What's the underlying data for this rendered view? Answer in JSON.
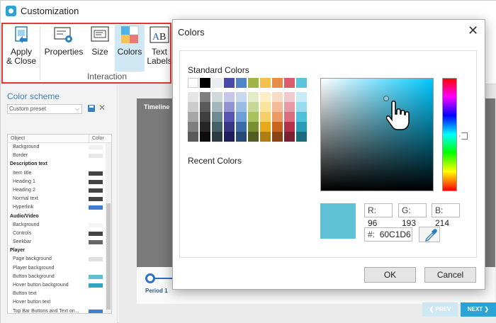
{
  "window": {
    "title": "Customization"
  },
  "ribbon": {
    "buttons": [
      {
        "label_line1": "Apply",
        "label_line2": "& Close",
        "icon": "apply-close-icon"
      },
      {
        "label": "Properties",
        "icon": "properties-icon"
      },
      {
        "label": "Size",
        "icon": "size-icon"
      },
      {
        "label": "Colors",
        "icon": "colors-icon",
        "selected": true
      },
      {
        "label_line1": "Text",
        "label_line2": "Labels",
        "icon": "text-labels-icon"
      }
    ],
    "group_label": "Interaction",
    "highlight_color": "#e53935"
  },
  "left_panel": {
    "color_scheme_label": "Color scheme",
    "preset": "Custom preset",
    "table_header": {
      "object": "Object",
      "color": "Color"
    },
    "rows": [
      {
        "type": "item",
        "label": "Background",
        "color": "#f0f0f0"
      },
      {
        "type": "item",
        "label": "Border",
        "color": "#e6e6e6"
      },
      {
        "type": "cat",
        "label": "Description text"
      },
      {
        "type": "item",
        "label": "Item title",
        "color": "#444444"
      },
      {
        "type": "item",
        "label": "Heading 1",
        "color": "#444444"
      },
      {
        "type": "item",
        "label": "Heading 2",
        "color": "#444444"
      },
      {
        "type": "item",
        "label": "Normal text",
        "color": "#444444"
      },
      {
        "type": "item",
        "label": "Hyperlink",
        "color": "#3d7fd6"
      },
      {
        "type": "cat",
        "label": "Audio/Video"
      },
      {
        "type": "item",
        "label": "Background",
        "color": "#f4f4f4"
      },
      {
        "type": "item",
        "label": "Controls",
        "color": "#444444"
      },
      {
        "type": "item",
        "label": "Seekbar",
        "color": "#666666"
      },
      {
        "type": "cat",
        "label": "Player"
      },
      {
        "type": "item",
        "label": "Page background",
        "color": "#e0e0e0"
      },
      {
        "type": "item",
        "label": "Player background",
        "color": "#ffffff"
      },
      {
        "type": "item",
        "label": "Button background",
        "color": "#60c1d6"
      },
      {
        "type": "item",
        "label": "Hover button background",
        "color": "#2fa6c0"
      },
      {
        "type": "item",
        "label": "Button text",
        "color": "#ffffff"
      },
      {
        "type": "item",
        "label": "Hover button text",
        "color": "#ffffff"
      },
      {
        "type": "item",
        "label": "Top Bar Buttons and Text on...",
        "color": "#3d7fd6"
      }
    ]
  },
  "preview": {
    "timeline_label": "Timeline",
    "period_label": "Period 1",
    "prev_label": "❮ PREV",
    "next_label": "NEXT ❯"
  },
  "dialog": {
    "title": "Colors",
    "standard_colors_label": "Standard Colors",
    "recent_colors_label": "Recent Colors",
    "standard_colors": [
      [
        "#ffffff",
        "#000000",
        "#e8edf0",
        "#4a4aa8",
        "#4f85c8",
        "#9fb54a",
        "#f2c14e",
        "#e88c4a",
        "#d95b6c",
        "#5fc3dc"
      ],
      [
        "#e5e5e5",
        "#7f7f7f",
        "#cfd9dc",
        "#c7c7e8",
        "#c6d9ef",
        "#e3ebc7",
        "#fcefc6",
        "#f8dcc6",
        "#f1c9cf",
        "#c7ecf5"
      ],
      [
        "#cccccc",
        "#595959",
        "#a4b6bc",
        "#9393d2",
        "#9bbce2",
        "#c7d79a",
        "#fae39b",
        "#f2bb95",
        "#e59aa6",
        "#98dbec"
      ],
      [
        "#a6a6a6",
        "#3f3f3f",
        "#6e8a93",
        "#5656b2",
        "#6c9fd6",
        "#a9c25c",
        "#f6d066",
        "#ec9a63",
        "#dc6d80",
        "#4fc0da"
      ],
      [
        "#7f7f7f",
        "#262626",
        "#46606a",
        "#363682",
        "#3a6da8",
        "#7a8f33",
        "#e8a91b",
        "#c8641e",
        "#b33249",
        "#2a9bb6"
      ],
      [
        "#595959",
        "#0d0d0d",
        "#2b3b41",
        "#1e1e5a",
        "#244a75",
        "#505e21",
        "#b07d10",
        "#8a4413",
        "#7a2031",
        "#1b6c80"
      ]
    ],
    "rgb": {
      "r_key": "R:",
      "r": "96",
      "g_key": "G:",
      "g": "193",
      "b_key": "B:",
      "b": "214"
    },
    "hex_key": "#:",
    "hex": "60C1D6",
    "current_color": "#60C1D6",
    "ok_label": "OK",
    "cancel_label": "Cancel"
  }
}
